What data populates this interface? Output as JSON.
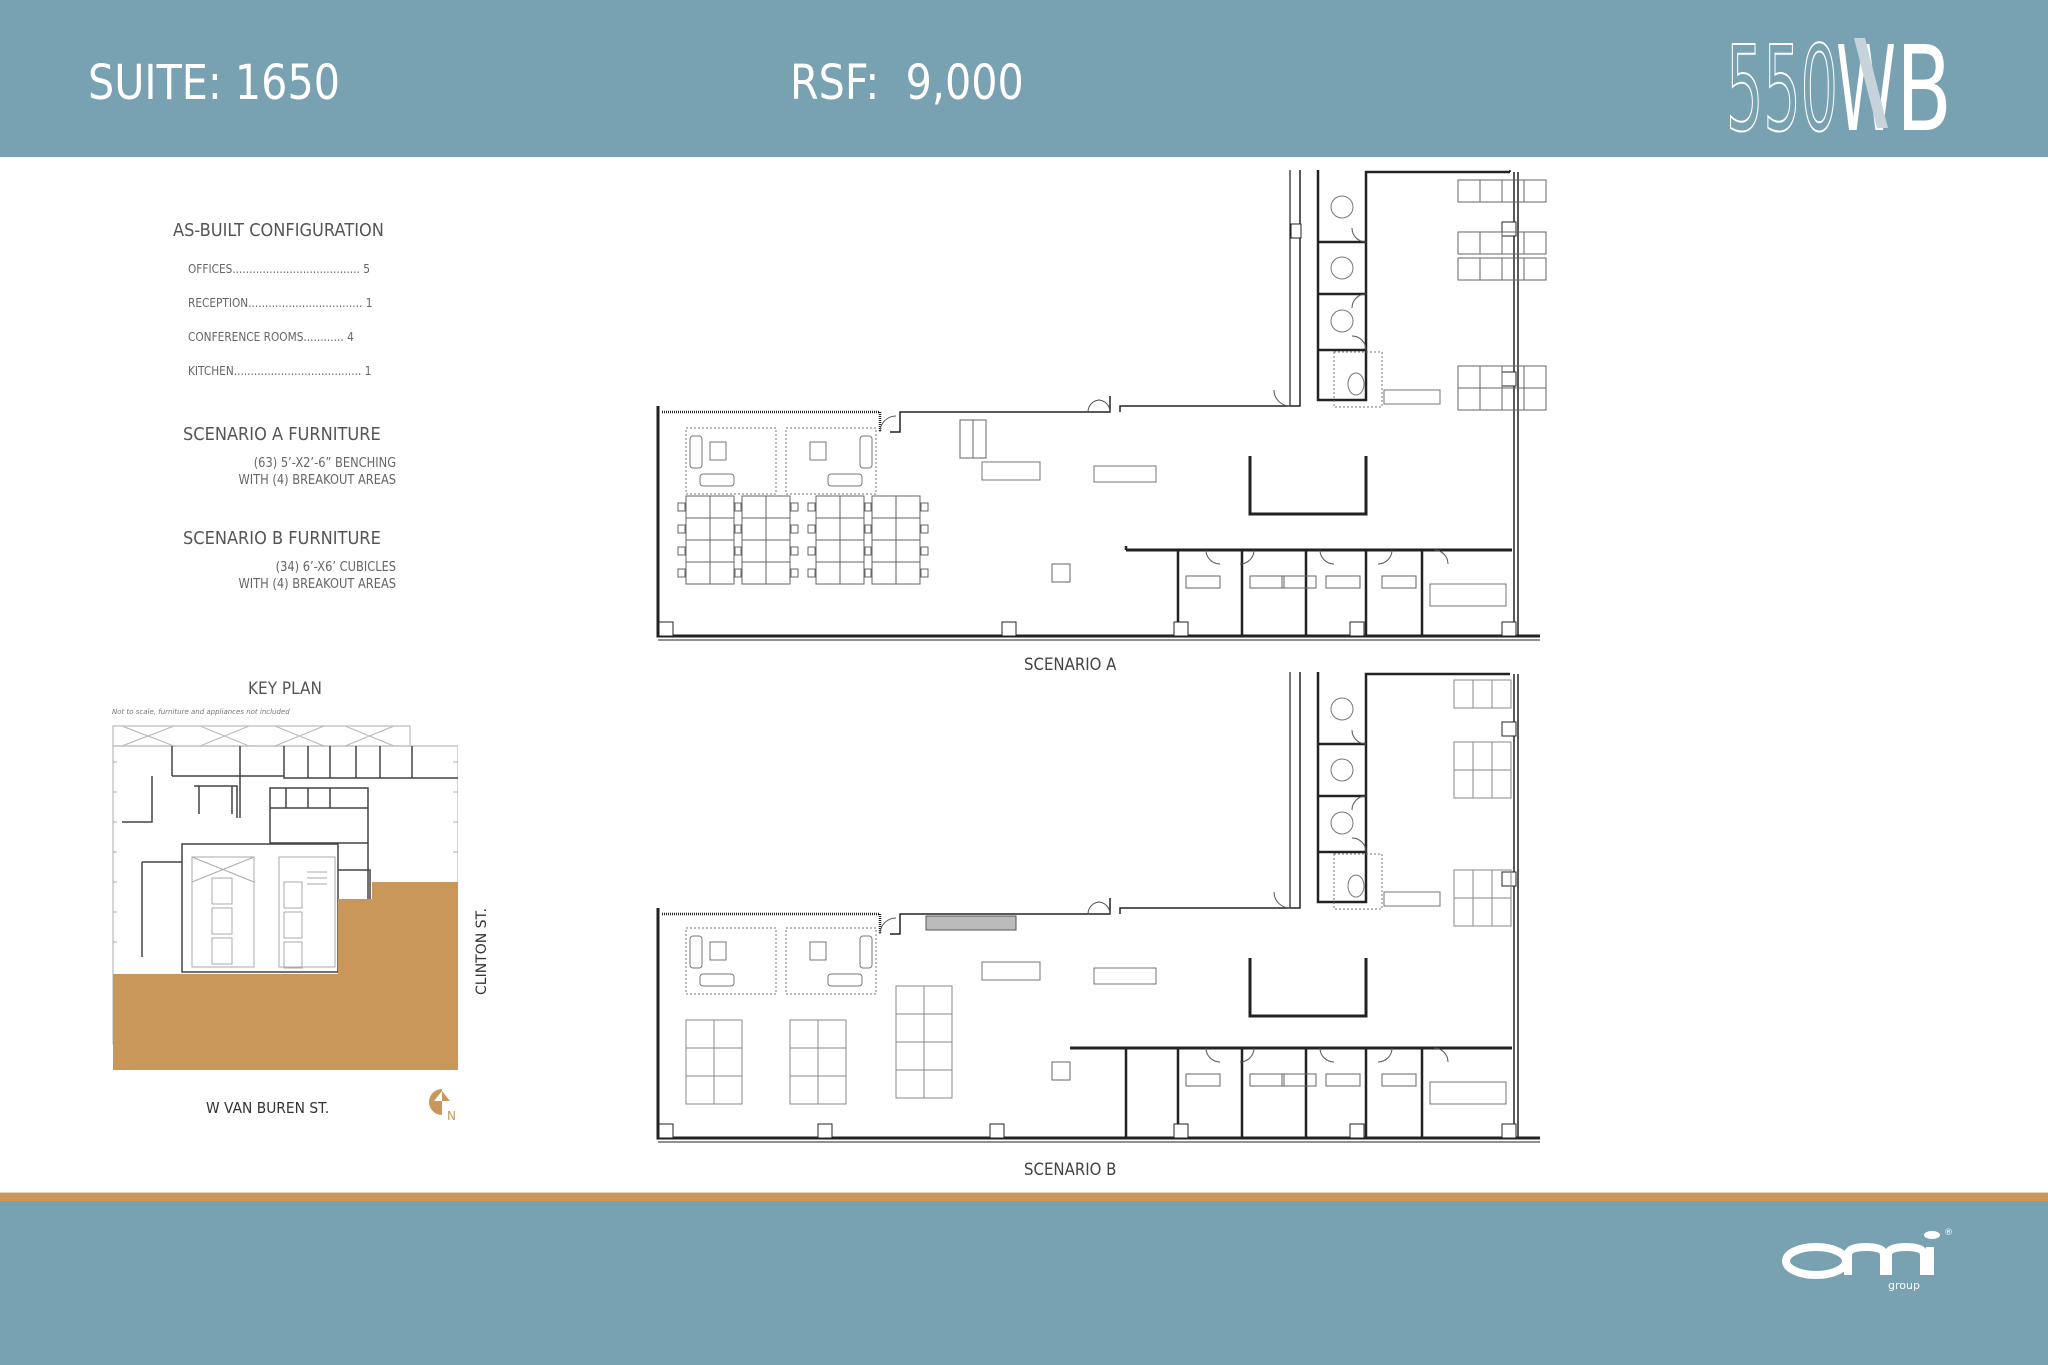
{
  "header": {
    "suite_label": "SUITE: 1650",
    "rsf_label": "RSF:  9,000",
    "building_logo": {
      "text_left": "550",
      "text_w": "W",
      "text_b": "B"
    }
  },
  "as_built": {
    "title": "AS-BUILT CONFIGURATION",
    "rows": [
      {
        "label": "OFFICES......................................",
        "value": "5"
      },
      {
        "label": "RECEPTION..................................",
        "value": "1"
      },
      {
        "label": "CONFERENCE ROOMS............",
        "value": "4"
      },
      {
        "label": "KITCHEN......................................",
        "value": " 1"
      }
    ]
  },
  "scenario_a_furniture": {
    "title": "SCENARIO A FURNITURE",
    "line1": "(63) 5’-X2’-6” BENCHING",
    "line2": "WITH (4) BREAKOUT AREAS"
  },
  "scenario_b_furniture": {
    "title": "SCENARIO B FURNITURE",
    "line1": "(34) 6’-X6’ CUBICLES",
    "line2": "WITH (4) BREAKOUT AREAS"
  },
  "key_plan": {
    "title": "KEY PLAN",
    "note": "Not to scale, furniture and appliances not included",
    "street_south": "W  VAN BUREN ST.",
    "street_east": "CLINTON ST.",
    "north_label": "N",
    "highlight_color": "#c9975a"
  },
  "plans": {
    "scenario_a_label": "SCENARIO A",
    "scenario_b_label": "SCENARIO B"
  },
  "footer": {
    "brand": "onni",
    "brand_sub": "group",
    "registered": "®"
  },
  "colors": {
    "header_bg": "#78a1b2",
    "accent_gold": "#c9975a",
    "text_gray": "#555555"
  }
}
